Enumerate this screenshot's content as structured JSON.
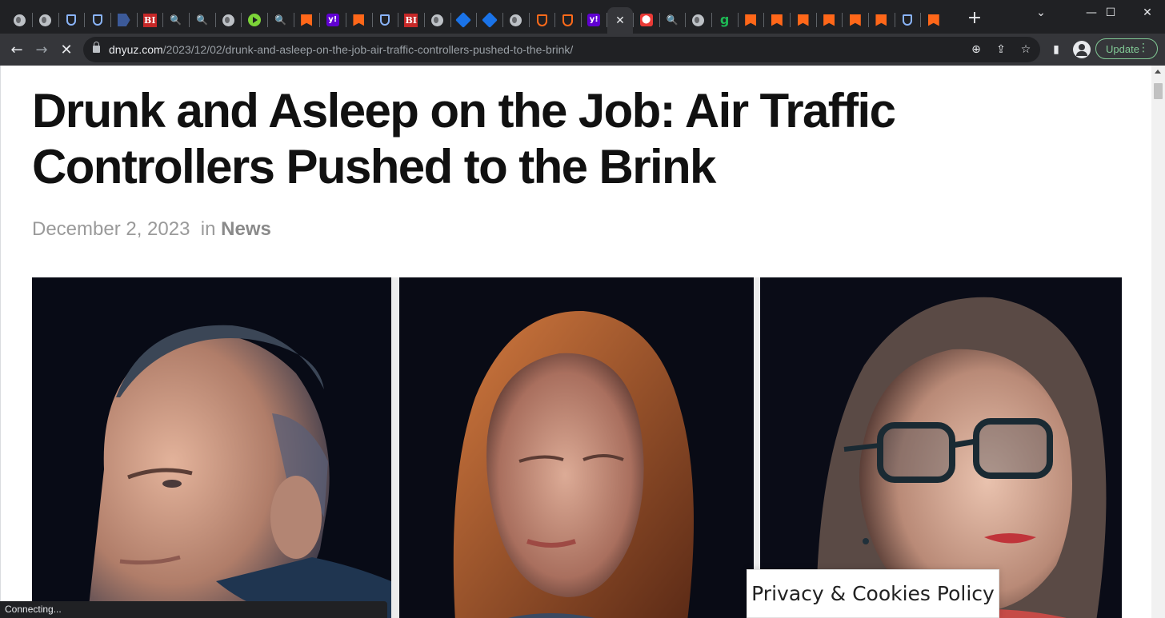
{
  "browser": {
    "tabs": [
      {
        "icon": "globe-icon",
        "glyph": ""
      },
      {
        "icon": "globe-icon",
        "glyph": ""
      },
      {
        "icon": "shield-icon",
        "glyph": ""
      },
      {
        "icon": "shield-icon",
        "glyph": ""
      },
      {
        "icon": "arrow-tag-icon",
        "glyph": ""
      },
      {
        "icon": "business-insider-icon",
        "glyph": "BI"
      },
      {
        "icon": "search-icon",
        "glyph": "🔍"
      },
      {
        "icon": "search-icon",
        "glyph": "🔍"
      },
      {
        "icon": "globe-icon",
        "glyph": ""
      },
      {
        "icon": "play-icon",
        "glyph": ""
      },
      {
        "icon": "search-icon",
        "glyph": "🔍"
      },
      {
        "icon": "substack-icon",
        "glyph": ""
      },
      {
        "icon": "yahoo-icon",
        "glyph": "y!"
      },
      {
        "icon": "substack-icon",
        "glyph": ""
      },
      {
        "icon": "shield-icon",
        "glyph": ""
      },
      {
        "icon": "business-insider-icon",
        "glyph": "BI"
      },
      {
        "icon": "globe-icon",
        "glyph": ""
      },
      {
        "icon": "cube-icon",
        "glyph": ""
      },
      {
        "icon": "cube-icon",
        "glyph": ""
      },
      {
        "icon": "globe-icon",
        "glyph": ""
      },
      {
        "icon": "ublock-icon",
        "glyph": ""
      },
      {
        "icon": "ublock-icon",
        "glyph": ""
      },
      {
        "icon": "yahoo-icon",
        "glyph": "y!"
      },
      {
        "icon": "close-icon",
        "glyph": "✕",
        "active": true
      },
      {
        "icon": "pin-icon",
        "glyph": "⬤"
      },
      {
        "icon": "search-icon",
        "glyph": "🔍"
      },
      {
        "icon": "globe-icon",
        "glyph": ""
      },
      {
        "icon": "g-icon",
        "glyph": "g"
      },
      {
        "icon": "substack-icon",
        "glyph": ""
      },
      {
        "icon": "substack-icon",
        "glyph": ""
      },
      {
        "icon": "substack-icon",
        "glyph": ""
      },
      {
        "icon": "substack-icon",
        "glyph": ""
      },
      {
        "icon": "substack-icon",
        "glyph": ""
      },
      {
        "icon": "substack-icon",
        "glyph": ""
      },
      {
        "icon": "shield-icon",
        "glyph": ""
      },
      {
        "icon": "substack-icon",
        "glyph": ""
      }
    ],
    "new_tab_glyph": "+",
    "window_controls": {
      "dropdown": "⌄",
      "minimize": "—",
      "maximize": "☐",
      "close": "✕"
    },
    "nav": {
      "back": "←",
      "forward": "→",
      "reload": "✕"
    },
    "url_host": "dnyuz.com",
    "url_path": "/2023/12/02/drunk-and-asleep-on-the-job-air-traffic-controllers-pushed-to-the-brink/",
    "omnibox_icons": {
      "zoom": "⊕",
      "share": "⇪",
      "bookmark": "☆"
    },
    "sidepanel_glyph": "▮",
    "update_label": "Update",
    "menu_glyph": "⋮",
    "status_text": "Connecting..."
  },
  "article": {
    "headline": "Drunk and Asleep on the Job: Air Traffic Controllers Pushed to the Brink",
    "date": "December 2, 2023",
    "in_label": "in",
    "category": "News"
  },
  "privacy_button": "Privacy & Cookies Policy"
}
